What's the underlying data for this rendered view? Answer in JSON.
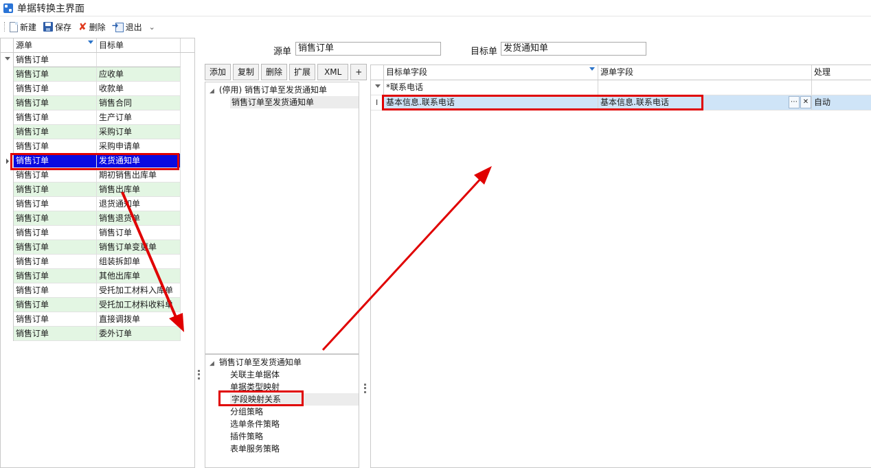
{
  "window": {
    "title": "单据转换主界面"
  },
  "toolbar": {
    "new_label": "新建",
    "save_label": "保存",
    "delete_label": "删除",
    "exit_label": "退出",
    "more_glyph": "⌄"
  },
  "left_grid": {
    "headers": {
      "source": "源单",
      "target": "目标单"
    },
    "filter_value": "销售订单",
    "rows": [
      {
        "source": "销售订单",
        "target": "应收单"
      },
      {
        "source": "销售订单",
        "target": "收款单"
      },
      {
        "source": "销售订单",
        "target": "销售合同"
      },
      {
        "source": "销售订单",
        "target": "生产订单"
      },
      {
        "source": "销售订单",
        "target": "采购订单"
      },
      {
        "source": "销售订单",
        "target": "采购申请单"
      },
      {
        "source": "销售订单",
        "target": "发货通知单"
      },
      {
        "source": "销售订单",
        "target": "期初销售出库单"
      },
      {
        "source": "销售订单",
        "target": "销售出库单"
      },
      {
        "source": "销售订单",
        "target": "退货通知单"
      },
      {
        "source": "销售订单",
        "target": "销售退货单"
      },
      {
        "source": "销售订单",
        "target": "销售订单"
      },
      {
        "source": "销售订单",
        "target": "销售订单变更单"
      },
      {
        "source": "销售订单",
        "target": "组装拆卸单"
      },
      {
        "source": "销售订单",
        "target": "其他出库单"
      },
      {
        "source": "销售订单",
        "target": "受托加工材料入库单"
      },
      {
        "source": "销售订单",
        "target": "受托加工材料收料单"
      },
      {
        "source": "销售订单",
        "target": "直接调拨单"
      },
      {
        "source": "销售订单",
        "target": "委外订单"
      }
    ]
  },
  "header_fields": {
    "source_label": "源单",
    "source_value": "销售订单",
    "target_label": "目标单",
    "target_value": "发货通知单"
  },
  "mid_toolbar": {
    "add": "添加",
    "copy": "复制",
    "delete": "删除",
    "extend": "扩展",
    "xml": "XML",
    "plus": "+"
  },
  "rule_tree": {
    "root": "(停用) 销售订单至发货通知单",
    "child": "销售订单至发货通知单"
  },
  "strategy_tree": {
    "root": "销售订单至发货通知单",
    "items": [
      "关联主单据体",
      "单据类型映射",
      "字段映射关系",
      "分组策略",
      "选单条件策略",
      "插件策略",
      "表单服务策略"
    ]
  },
  "field_map": {
    "headers": {
      "target_field": "目标单字段",
      "source_field": "源单字段",
      "process": "处理"
    },
    "filter_text": "*联系电话",
    "row": {
      "target_field": "基本信息.联系电话",
      "source_field": "基本信息.联系电话",
      "process": "自动"
    }
  },
  "colors": {
    "highlight_red": "#e00000",
    "selected_row": "#0a0ae0",
    "green_row": "#e3f6e3",
    "active_row": "#cfe4f7"
  }
}
